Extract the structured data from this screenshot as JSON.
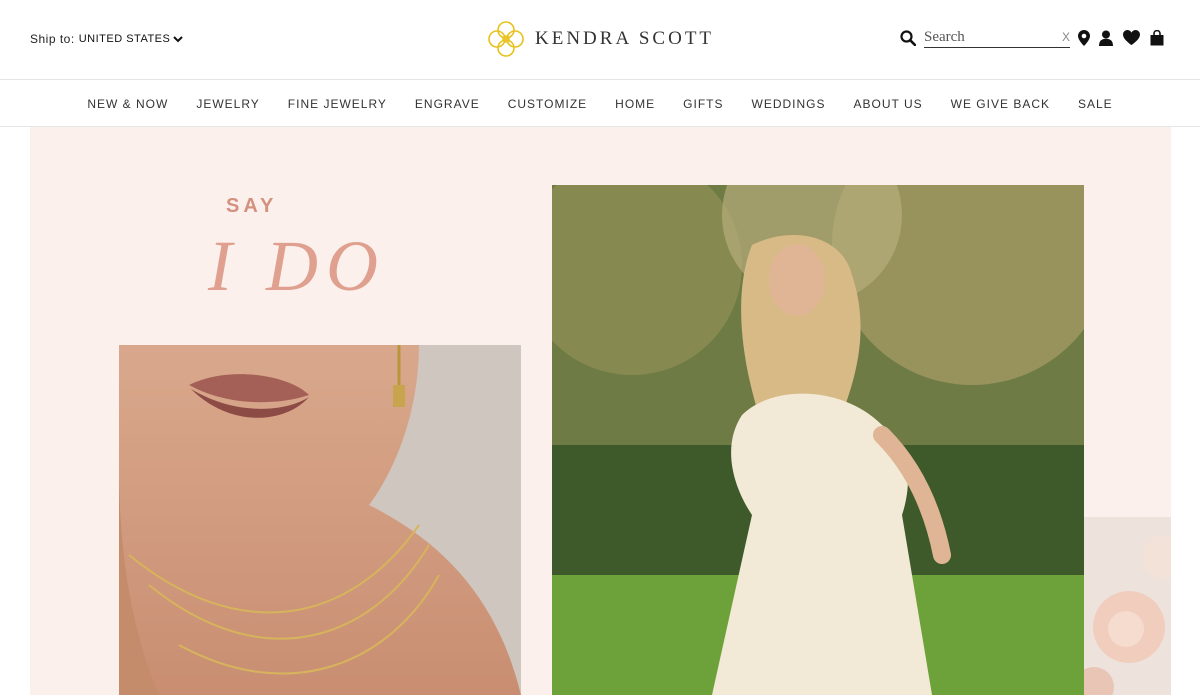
{
  "header": {
    "ship_label": "Ship to:",
    "ship_country": "UNITED STATES",
    "brand_name": "KENDRA SCOTT",
    "search_placeholder": "Search",
    "search_clear": "X"
  },
  "nav": {
    "items": [
      {
        "label": "NEW & NOW"
      },
      {
        "label": "JEWELRY"
      },
      {
        "label": "FINE JEWELRY"
      },
      {
        "label": "ENGRAVE"
      },
      {
        "label": "CUSTOMIZE"
      },
      {
        "label": "HOME"
      },
      {
        "label": "GIFTS"
      },
      {
        "label": "WEDDINGS"
      },
      {
        "label": "ABOUT US"
      },
      {
        "label": "WE GIVE BACK"
      },
      {
        "label": "SALE"
      }
    ]
  },
  "hero": {
    "say": "SAY",
    "ido": "I DO"
  },
  "icons": {
    "logo": "kendra-scott-flower-icon",
    "search": "search-icon",
    "location": "map-pin-icon",
    "account": "user-icon",
    "wishlist": "heart-icon",
    "bag": "shopping-bag-icon",
    "dropdown": "chevron-down-icon"
  },
  "colors": {
    "accent_gold": "#e8c21c",
    "hero_bg": "#fbf0ec",
    "headline_pink": "#e0a08f"
  }
}
